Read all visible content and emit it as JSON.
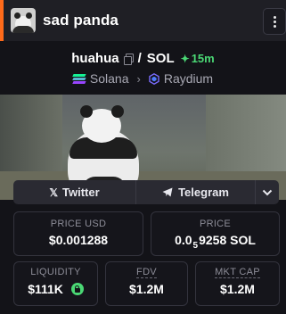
{
  "header": {
    "token_name": "sad panda",
    "accent_color": "#ff6a1a"
  },
  "pair": {
    "base": "huahua",
    "separator": "/",
    "quote": "SOL",
    "age": "15m",
    "chain": "Solana",
    "dex": "Raydium"
  },
  "social": {
    "twitter_label": "Twitter",
    "telegram_label": "Telegram"
  },
  "stats": {
    "price_usd_label": "PRICE USD",
    "price_usd_value": "$0.001288",
    "price_label": "PRICE",
    "price_value_prefix": "0.0",
    "price_value_zeros": "5",
    "price_value_suffix": "9258 SOL",
    "liquidity_label": "LIQUIDITY",
    "liquidity_value": "$111K",
    "fdv_label": "FDV",
    "fdv_value": "$1.2M",
    "mktcap_label": "MKT CAP",
    "mktcap_value": "$1.2M"
  },
  "colors": {
    "positive": "#4ad774",
    "background": "#131318"
  }
}
